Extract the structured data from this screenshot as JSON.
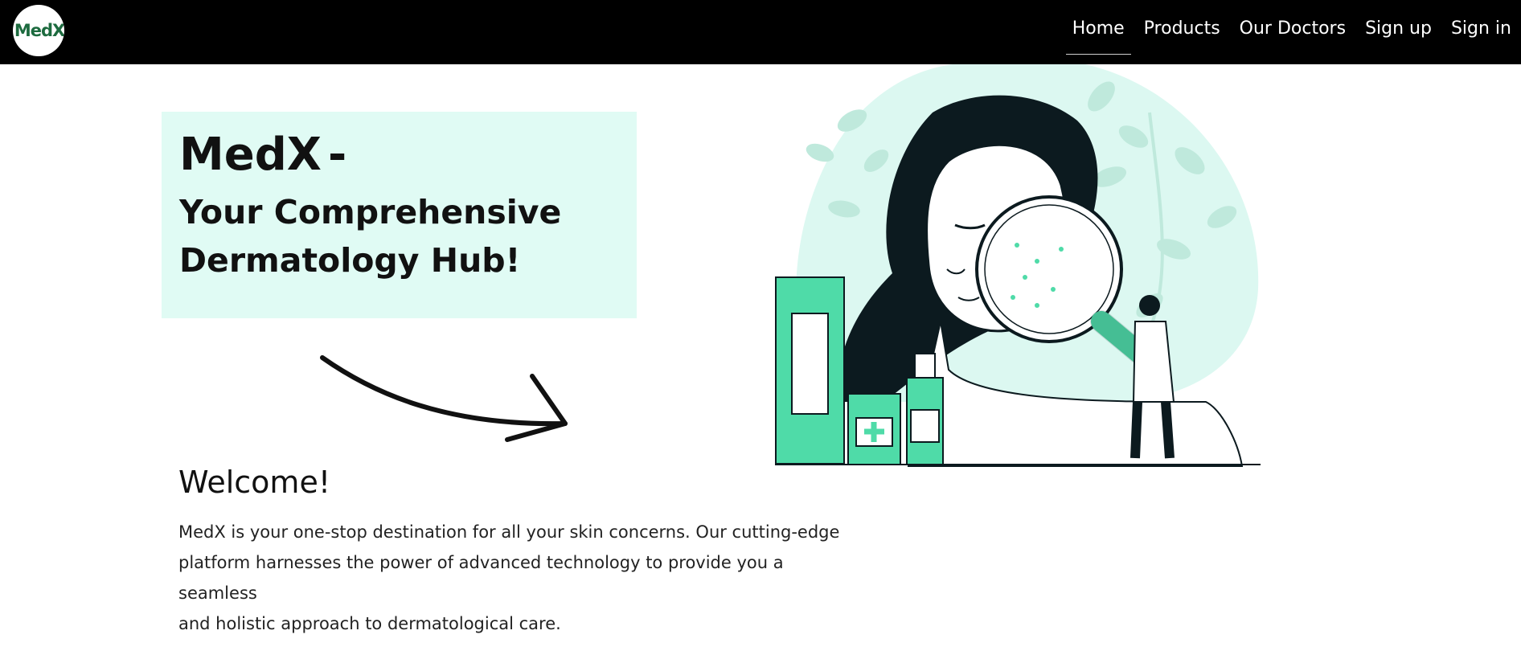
{
  "brand": {
    "logo_text": "MedX",
    "logo_color": "#1d6b3f"
  },
  "nav": {
    "items": [
      {
        "label": "Home",
        "active": true
      },
      {
        "label": "Products"
      },
      {
        "label": "Our Doctors"
      },
      {
        "label": "Sign up"
      },
      {
        "label": "Sign in"
      }
    ]
  },
  "hero": {
    "brand": "MedX",
    "dash": "-",
    "tagline_line1": "Your Comprehensive",
    "tagline_line2": "Dermatology Hub!",
    "box_color": "#e0fbf4"
  },
  "welcome": {
    "title": "Welcome!",
    "line1": "MedX is your one-stop destination for all your skin concerns. Our cutting-edge",
    "line2": "platform harnesses the power of advanced technology to provide you a seamless",
    "line3": "and holistic approach to dermatological care."
  },
  "illustration": {
    "icon": "dermatology-illustration",
    "accent_color": "#4fdba8",
    "blob_color": "#dcf8f1",
    "leaf_color": "#bfe9dc",
    "dark_color": "#0c1a1f"
  }
}
